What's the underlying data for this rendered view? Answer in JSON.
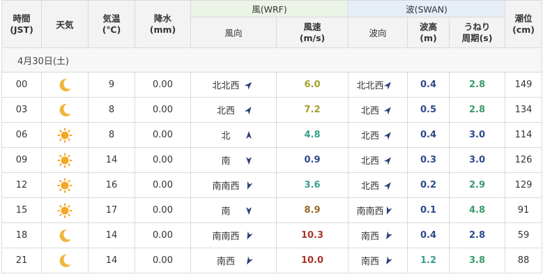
{
  "header": {
    "time": "時間\n(JST)",
    "weather": "天気",
    "temp": "気温\n(℃)",
    "precip": "降水\n(mm)",
    "wind_group": "風(WRF)",
    "wave_group": "波(SWAN)",
    "wind_dir": "風向",
    "wind_speed": "風速\n(m/s)",
    "wave_dir": "波向",
    "wave_height": "波高\n(m)",
    "swell_period": "うねり\n周期(s)",
    "tide": "潮位\n(cm)"
  },
  "date_label": "4月30日(土)",
  "rows": [
    {
      "time": "00",
      "weather": "moon-icon",
      "temp": "9",
      "precip": "0.00",
      "wind_dir": "北北西",
      "wind_speed": "6.0",
      "wave_dir": "北北西",
      "wave_height": "0.4",
      "swell_period": "2.8",
      "tide": "149"
    },
    {
      "time": "03",
      "weather": "moon-icon",
      "temp": "8",
      "precip": "0.00",
      "wind_dir": "北西",
      "wind_speed": "7.2",
      "wave_dir": "北西",
      "wave_height": "0.5",
      "swell_period": "2.8",
      "tide": "134"
    },
    {
      "time": "06",
      "weather": "sun-icon",
      "temp": "8",
      "precip": "0.00",
      "wind_dir": "北",
      "wind_speed": "4.8",
      "wave_dir": "北西",
      "wave_height": "0.4",
      "swell_period": "3.0",
      "tide": "114"
    },
    {
      "time": "09",
      "weather": "sun-icon",
      "temp": "14",
      "precip": "0.00",
      "wind_dir": "南",
      "wind_speed": "0.9",
      "wave_dir": "北西",
      "wave_height": "0.3",
      "swell_period": "3.0",
      "tide": "126"
    },
    {
      "time": "12",
      "weather": "sun-icon",
      "temp": "16",
      "precip": "0.00",
      "wind_dir": "南南西",
      "wind_speed": "3.6",
      "wave_dir": "北西",
      "wave_height": "0.2",
      "swell_period": "2.9",
      "tide": "129"
    },
    {
      "time": "15",
      "weather": "sun-icon",
      "temp": "17",
      "precip": "0.00",
      "wind_dir": "南",
      "wind_speed": "8.9",
      "wave_dir": "南南西",
      "wave_height": "0.1",
      "swell_period": "4.8",
      "tide": "91"
    },
    {
      "time": "18",
      "weather": "moon-icon",
      "temp": "14",
      "precip": "0.00",
      "wind_dir": "南南西",
      "wind_speed": "10.3",
      "wave_dir": "南西",
      "wave_height": "0.4",
      "swell_period": "2.8",
      "tide": "59"
    },
    {
      "time": "21",
      "weather": "moon-icon",
      "temp": "14",
      "precip": "0.00",
      "wind_dir": "南西",
      "wind_speed": "10.0",
      "wave_dir": "南西",
      "wave_height": "1.2",
      "swell_period": "3.8",
      "tide": "88"
    }
  ],
  "colors": {
    "wind_group_bg": "#eaf3e6",
    "wave_group_bg": "#e6eef8",
    "header_bg": "#f3f3f3",
    "moon": "#f0b53a",
    "sun": "#f5a623",
    "arrow": "#2e3f7a"
  }
}
